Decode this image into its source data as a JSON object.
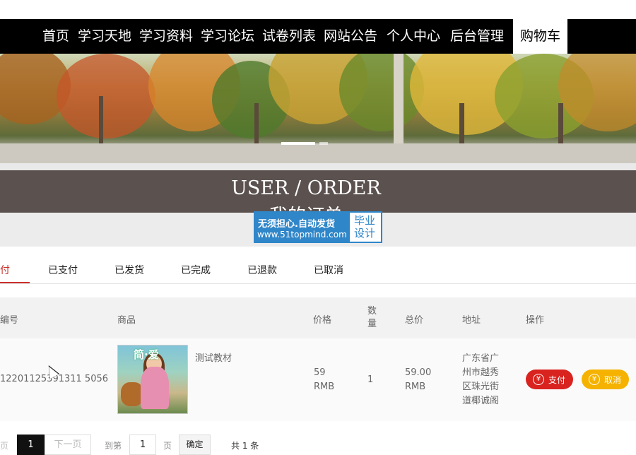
{
  "nav": {
    "items": [
      {
        "label": "首页"
      },
      {
        "label": "学习天地"
      },
      {
        "label": "学习资料"
      },
      {
        "label": "学习论坛"
      },
      {
        "label": "试卷列表"
      },
      {
        "label": "网站公告"
      },
      {
        "label": "个人中心"
      },
      {
        "label": "后台管理"
      },
      {
        "label": "购物车"
      }
    ],
    "active_label": "购物车"
  },
  "banner": {
    "title_en": "USER / ORDER",
    "title_cn": "我的订单"
  },
  "watermark": {
    "line1": "无须担心.自动发货",
    "line2": "www.51topmind.com",
    "right": "毕业设计"
  },
  "tabs": [
    "支付",
    "已支付",
    "已发货",
    "已完成",
    "已退款",
    "已取消"
  ],
  "table": {
    "headers": {
      "order_no": "编号",
      "product": "商品",
      "price": "价格",
      "qty": "数量",
      "total": "总价",
      "address": "地址",
      "action": "操作"
    },
    "rows": [
      {
        "order_no": "1220112539131150 56",
        "order_no_display": "12201125391311 5056",
        "product_name": "测试教材",
        "book_cover_title": "简·爱",
        "price": "59 RMB",
        "price_num": "59",
        "price_unit": "RMB",
        "qty": "1",
        "total_num": "59.00",
        "total_unit": "RMB",
        "address": "广东省广州市越秀区珠光街道椰诚阁",
        "address_lines": [
          "广东省广",
          "州市越秀",
          "区珠光街",
          "道椰诚阁"
        ],
        "pay_label": "支付",
        "cancel_label": "取消",
        "currency_icon": "¥"
      }
    ]
  },
  "pager": {
    "prev": "上一页",
    "prev_visible": "页",
    "current": "1",
    "next": "下一页",
    "goto_prefix": "到第",
    "goto_value": "1",
    "goto_suffix": "页",
    "confirm": "确定",
    "total": "共 1 条"
  },
  "colors": {
    "nav_bg": "#000000",
    "accent_red": "#d9231f",
    "accent_yellow": "#f5b200",
    "title_band": "#5b5250"
  }
}
